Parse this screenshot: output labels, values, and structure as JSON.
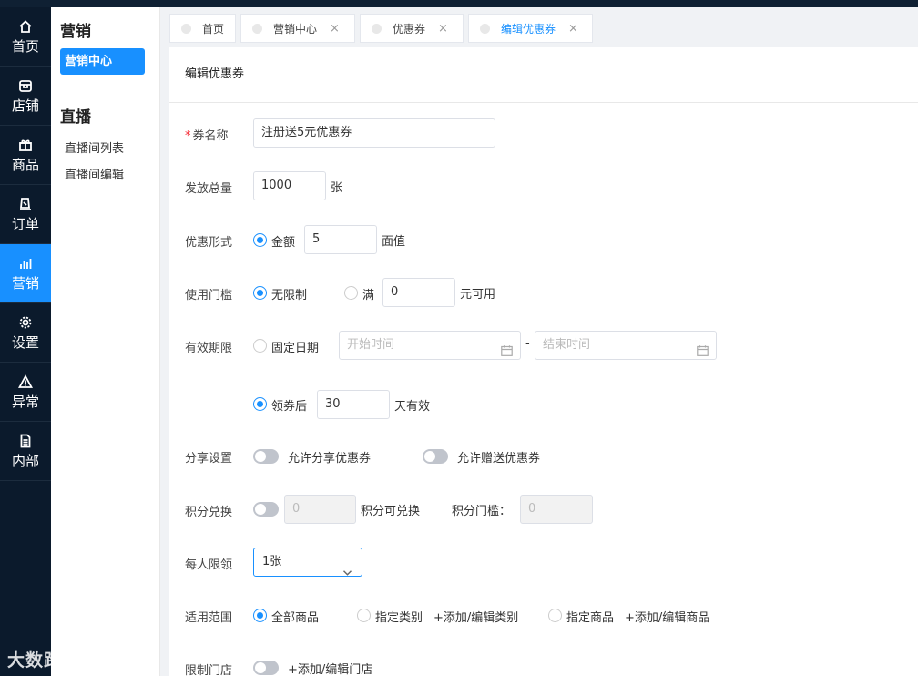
{
  "nav": [
    {
      "icon": "home-icon",
      "label": "首页"
    },
    {
      "icon": "store-icon",
      "label": "店铺"
    },
    {
      "icon": "gift-icon",
      "label": "商品"
    },
    {
      "icon": "order-icon",
      "label": "订单"
    },
    {
      "icon": "chart-icon",
      "label": "营销"
    },
    {
      "icon": "gear-icon",
      "label": "设置"
    },
    {
      "icon": "warning-icon",
      "label": "异常"
    },
    {
      "icon": "document-icon",
      "label": "内部"
    }
  ],
  "sidebar": {
    "group1_title": "营销",
    "group1_item": "营销中心",
    "group2_title": "直播",
    "group2_items": [
      "直播间列表",
      "直播间编辑"
    ]
  },
  "tabs": [
    {
      "label": "首页",
      "closable": false
    },
    {
      "label": "营销中心",
      "closable": true
    },
    {
      "label": "优惠券",
      "closable": true
    },
    {
      "label": "编辑优惠券",
      "closable": true
    }
  ],
  "tab_close": "×",
  "panel_title": "编辑优惠券",
  "form": {
    "name": {
      "required_mark": "*",
      "label": "券名称",
      "value": "注册送5元优惠券"
    },
    "total": {
      "label": "发放总量",
      "value": "1000",
      "unit": "张"
    },
    "type": {
      "label": "优惠形式",
      "option": "金额",
      "value": "5",
      "unit": "面值"
    },
    "threshold": {
      "label": "使用门槛",
      "opt_none": "无限制",
      "opt_full": "满",
      "value": "0",
      "unit": "元可用"
    },
    "validity": {
      "label": "有效期限",
      "opt_fixed": "固定日期",
      "start_placeholder": "开始时间",
      "sep": "-",
      "end_placeholder": "结束时间",
      "opt_after": "领券后",
      "days": "30",
      "days_unit": "天有效"
    },
    "share": {
      "label": "分享设置",
      "allow_share": "允许分享优惠券",
      "allow_gift": "允许赠送优惠券"
    },
    "points": {
      "label": "积分兑换",
      "value": "0",
      "text": "积分可兑换",
      "threshold_label": "积分门槛：",
      "threshold_value": "0"
    },
    "limit": {
      "label": "每人限领",
      "value": "1张"
    },
    "scope": {
      "label": "适用范围",
      "opt_all": "全部商品",
      "opt_category": "指定类别",
      "add_category": "+添加/编辑类别",
      "opt_goods": "指定商品",
      "add_goods": "+添加/编辑商品"
    },
    "stores": {
      "label": "限制门店",
      "add_store": "+添加/编辑门店"
    }
  },
  "watermark": "大数跨境",
  "colors": {
    "accent": "#1890ff",
    "nav_bg": "#0b1a2c",
    "required": "#f5222d"
  }
}
